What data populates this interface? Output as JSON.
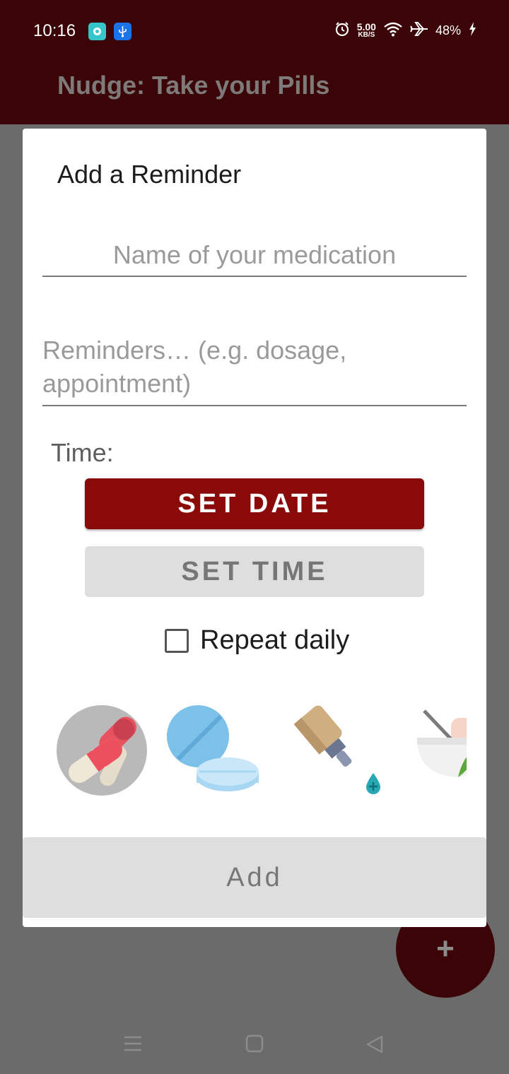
{
  "status_bar": {
    "time": "10:16",
    "speed_value": "5.00",
    "speed_unit": "KB/S",
    "battery": "48%",
    "icons": [
      "chat-notification-icon",
      "usb-icon",
      "alarm-icon",
      "wifi-icon",
      "airplane-icon",
      "charging-icon"
    ]
  },
  "app_bar": {
    "title": "Nudge: Take your Pills"
  },
  "dialog": {
    "title": "Add a Reminder",
    "medication_name": {
      "value": "",
      "placeholder": "Name of your medication"
    },
    "reminders": {
      "value": "",
      "placeholder": "Reminders… (e.g. dosage, appointment)"
    },
    "time_label": "Time:",
    "set_date_label": "SET DATE",
    "set_time_label": "SET TIME",
    "repeat_daily_label": "Repeat daily",
    "repeat_daily_checked": false,
    "med_icons": [
      "capsule-icon",
      "tablet-icon",
      "dropper-bottle-icon",
      "herbal-bowl-icon"
    ],
    "selected_icon": "capsule-icon",
    "add_label": "Add"
  },
  "fab": {
    "label": "+"
  },
  "colors": {
    "primary_dark": "#3b0406",
    "accent": "#8a0a0a",
    "disabled_button": "#dedede"
  }
}
